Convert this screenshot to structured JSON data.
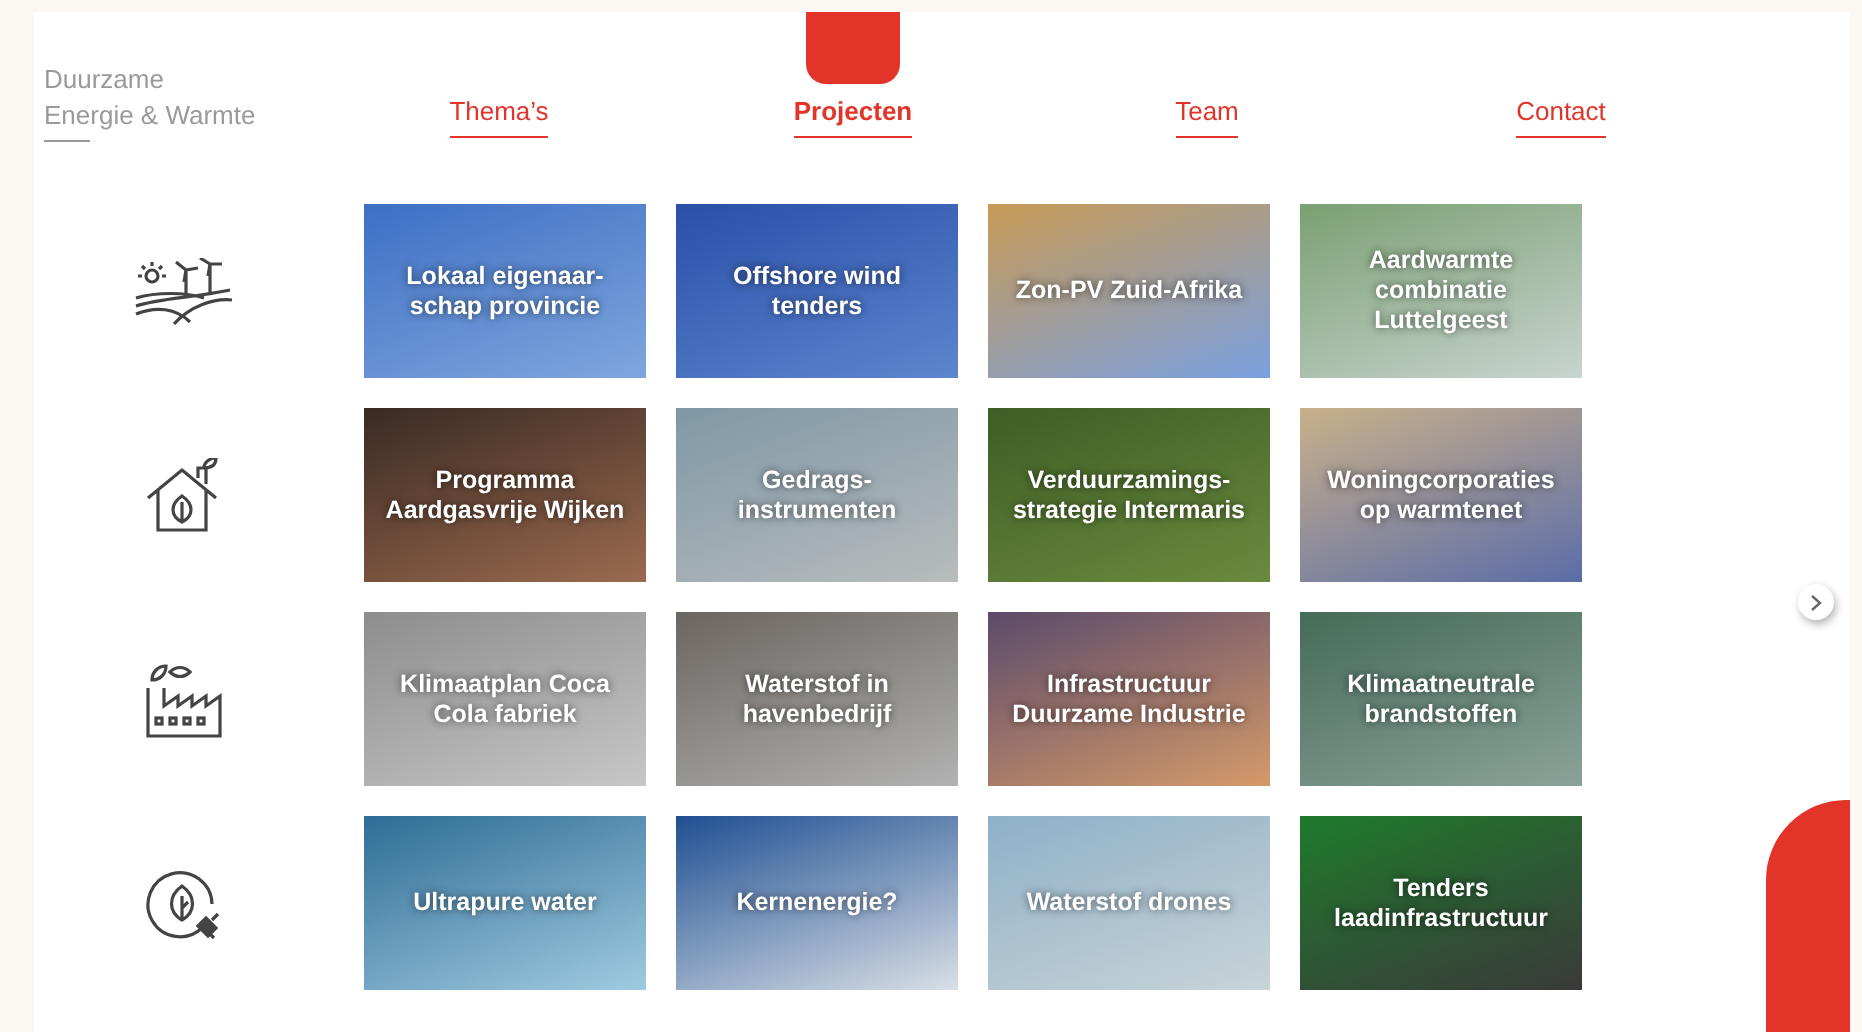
{
  "brand": {
    "lines": [
      "Duurzame",
      "Energie & Warmte"
    ]
  },
  "nav": [
    {
      "label": "Thema’s",
      "selected": false
    },
    {
      "label": "Projecten",
      "selected": true
    },
    {
      "label": "Team",
      "selected": false
    },
    {
      "label": "Contact",
      "selected": false
    }
  ],
  "rows": [
    {
      "kind": "landscape",
      "tiles": [
        "Lokaal eigenaar-schap provincie",
        "Offshore wind tenders",
        "Zon-PV Zuid-Afrika",
        "Aardwarmte combinatie Luttelgeest"
      ]
    },
    {
      "kind": "house",
      "tiles": [
        "Programma Aardgasvrije Wijken",
        "Gedrags-instrumenten",
        "Verduurzamings-strategie Intermaris",
        "Woningcorporaties op warmtenet"
      ]
    },
    {
      "kind": "factory",
      "tiles": [
        "Klimaatplan Coca Cola fabriek",
        "Waterstof in havenbedrijf",
        "Infrastructuur Duurzame Industrie",
        "Klimaatneutrale brandstoffen"
      ]
    },
    {
      "kind": "plug",
      "tiles": [
        "Ultrapure water",
        "Kernenergie?",
        "Waterstof drones",
        "Tenders laadinfrastructuur"
      ]
    }
  ]
}
